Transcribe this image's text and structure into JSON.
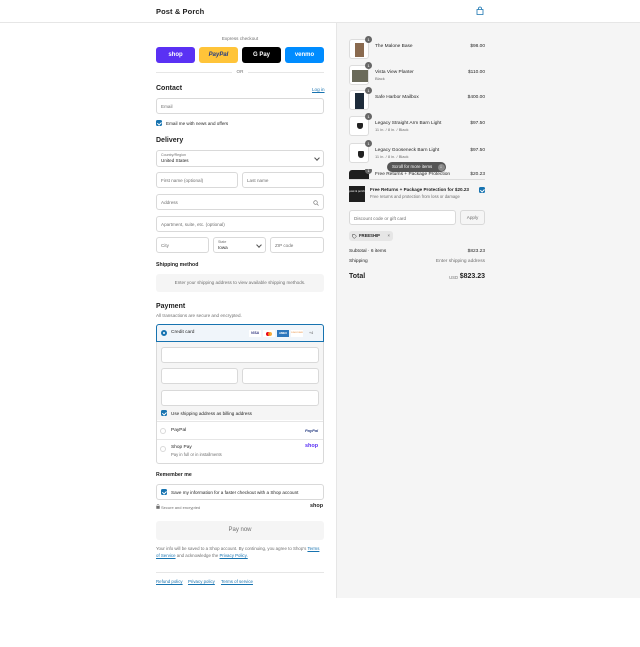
{
  "header": {
    "brand": "Post & Porch",
    "cart_icon": "shopping-bag-icon"
  },
  "express": {
    "title": "Express checkout",
    "buttons": [
      {
        "label": "shop",
        "color": "#5a31f4"
      },
      {
        "label": "PayPal",
        "color": "#ffc439"
      },
      {
        "label": "G Pay",
        "color": "#000000"
      },
      {
        "label": "venmo",
        "color": "#008cff"
      }
    ],
    "or": "OR"
  },
  "contact": {
    "title": "Contact",
    "login": "Log in",
    "email_placeholder": "Email",
    "news_label": "Email me with news and offers"
  },
  "delivery": {
    "title": "Delivery",
    "country_label": "Country/Region",
    "country_value": "United States",
    "first_name": "First name (optional)",
    "last_name": "Last name",
    "address": "Address",
    "apartment": "Apartment, suite, etc. (optional)",
    "city": "City",
    "state_label": "State",
    "state_value": "Iowa",
    "zip": "ZIP code"
  },
  "shipping_method": {
    "title": "Shipping method",
    "message": "Enter your shipping address to view available shipping methods."
  },
  "payment": {
    "title": "Payment",
    "subtitle": "All transactions are secure and encrypted.",
    "credit_card": "Credit card",
    "card_brands": [
      "VISA",
      "MC",
      "AMEX",
      "DISCOVER",
      "+4"
    ],
    "billing_label": "Use shipping address as billing address",
    "paypal": "PayPal",
    "paypal_logo": "PayPal",
    "shoppay": "Shop Pay",
    "shoppay_sub": "Pay in full or in installments",
    "shoppay_logo": "shop"
  },
  "remember": {
    "title": "Remember me",
    "label": "Save my information for a faster checkout with a Shop account",
    "secure": "Secure and encrypted",
    "shop_logo": "shop"
  },
  "pay_now": "Pay now",
  "disclaimer": {
    "line1": "Your info will be saved to a Shop account. By continuing, you agree to Shop's",
    "terms": "Terms of Service",
    "and": "and acknowledge the",
    "privacy": "Privacy Policy."
  },
  "footer_links": [
    "Refund policy",
    "Privacy policy",
    "Terms of service"
  ],
  "cart": {
    "items": [
      {
        "qty": "1",
        "name": "The Malone Base",
        "sub": "",
        "price": "$98.00"
      },
      {
        "qty": "1",
        "name": "Vista View Planter",
        "sub": "Black",
        "price": "$110.00"
      },
      {
        "qty": "1",
        "name": "Safe Harbor Mailbox",
        "sub": "",
        "price": "$400.00"
      },
      {
        "qty": "1",
        "name": "Legacy Straight Arm Barn Light",
        "sub": "11 in. / 8 in. / Black",
        "price": "$97.50"
      },
      {
        "qty": "1",
        "name": "Legacy Gooseneck Barn Light",
        "sub": "11 in. / 8 in. / Black",
        "price": "$97.50"
      },
      {
        "qty": "1",
        "name": "Free Returns + Package Protection",
        "sub": "",
        "price": "$20.23"
      }
    ],
    "scroll_hint": "Scroll for more items",
    "protection_title": "Free Returns + Package Protection for $20.23",
    "protection_sub": "Free returns and protection from loss or damage",
    "protection_logo": "post & porch",
    "discount_placeholder": "Discount code or gift card",
    "apply": "Apply",
    "code": "FREESHIP",
    "subtotal_label": "Subtotal · 6 items",
    "subtotal_value": "$823.23",
    "shipping_label": "Shipping",
    "shipping_value": "Enter shipping address",
    "total_label": "Total",
    "currency": "USD",
    "total_value": "$823.23"
  }
}
